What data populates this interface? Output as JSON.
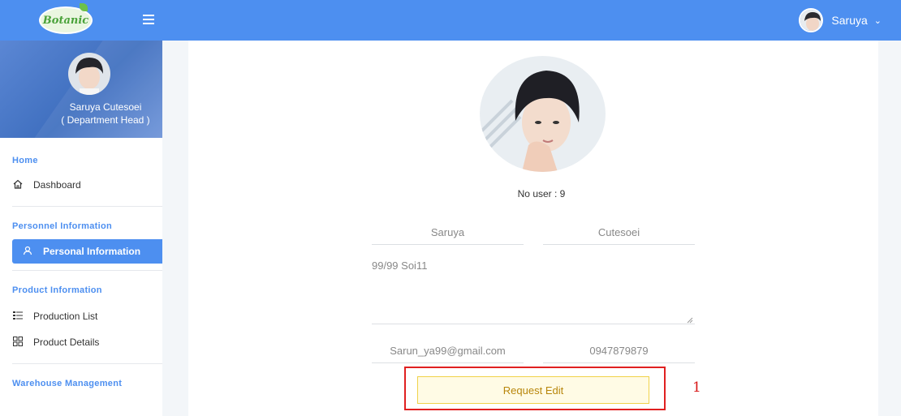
{
  "topbar": {
    "logo_text": "Botanic",
    "user_name": "Saruya",
    "chevron": "⌄"
  },
  "sidebar": {
    "profile": {
      "name": "Saruya Cutesoei",
      "role": "( Department Head )"
    },
    "sections": [
      {
        "label": "Home",
        "items": [
          {
            "label": "Dashboard",
            "icon": "home-icon"
          }
        ]
      },
      {
        "label": "Personnel Information",
        "items": [
          {
            "label": "Personal Information",
            "icon": "user-icon",
            "active": true
          }
        ]
      },
      {
        "label": "Product Information",
        "items": [
          {
            "label": "Production List",
            "icon": "list-icon"
          },
          {
            "label": "Product Details",
            "icon": "grid-icon"
          }
        ]
      },
      {
        "label": "Warehouse Management",
        "items": []
      }
    ]
  },
  "main": {
    "no_user": "No user : 9",
    "first_name": "Saruya",
    "last_name": "Cutesoei",
    "address": "99/99 Soi11",
    "email": "Sarun_ya99@gmail.com",
    "phone": "0947879879",
    "request_edit_label": "Request Edit",
    "annotation_number": "1"
  },
  "colors": {
    "primary": "#4d8ff0",
    "highlight_border": "#e02020",
    "button_border": "#f0d24a",
    "button_text": "#b8860b"
  }
}
